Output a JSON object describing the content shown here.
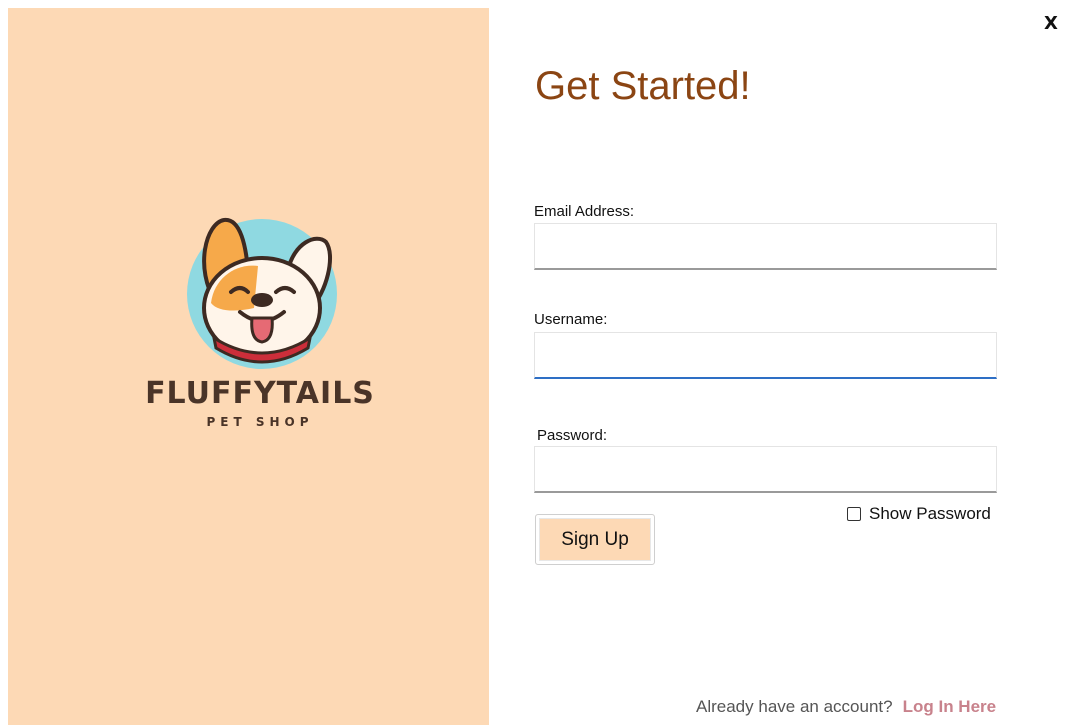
{
  "window": {
    "close_label": "X"
  },
  "brand": {
    "name": "FLUFFYTAILS",
    "subtitle": "PET SHOP",
    "logo_icon": "dog-face-icon",
    "panel_color": "#fdd9b5"
  },
  "form": {
    "title": "Get Started!",
    "email": {
      "label": "Email Address:",
      "value": "",
      "placeholder": ""
    },
    "username": {
      "label": "Username:",
      "value": "",
      "placeholder": ""
    },
    "password": {
      "label": "Password:",
      "value": "",
      "placeholder": ""
    },
    "show_password": {
      "label": "Show Password",
      "checked": false
    },
    "submit_label": "Sign Up"
  },
  "footer": {
    "prompt": "Already have an account?",
    "link_label": "Log In Here"
  },
  "colors": {
    "title": "#8b4513",
    "accent_focus": "#2e6fc5",
    "link": "#c8828c"
  }
}
